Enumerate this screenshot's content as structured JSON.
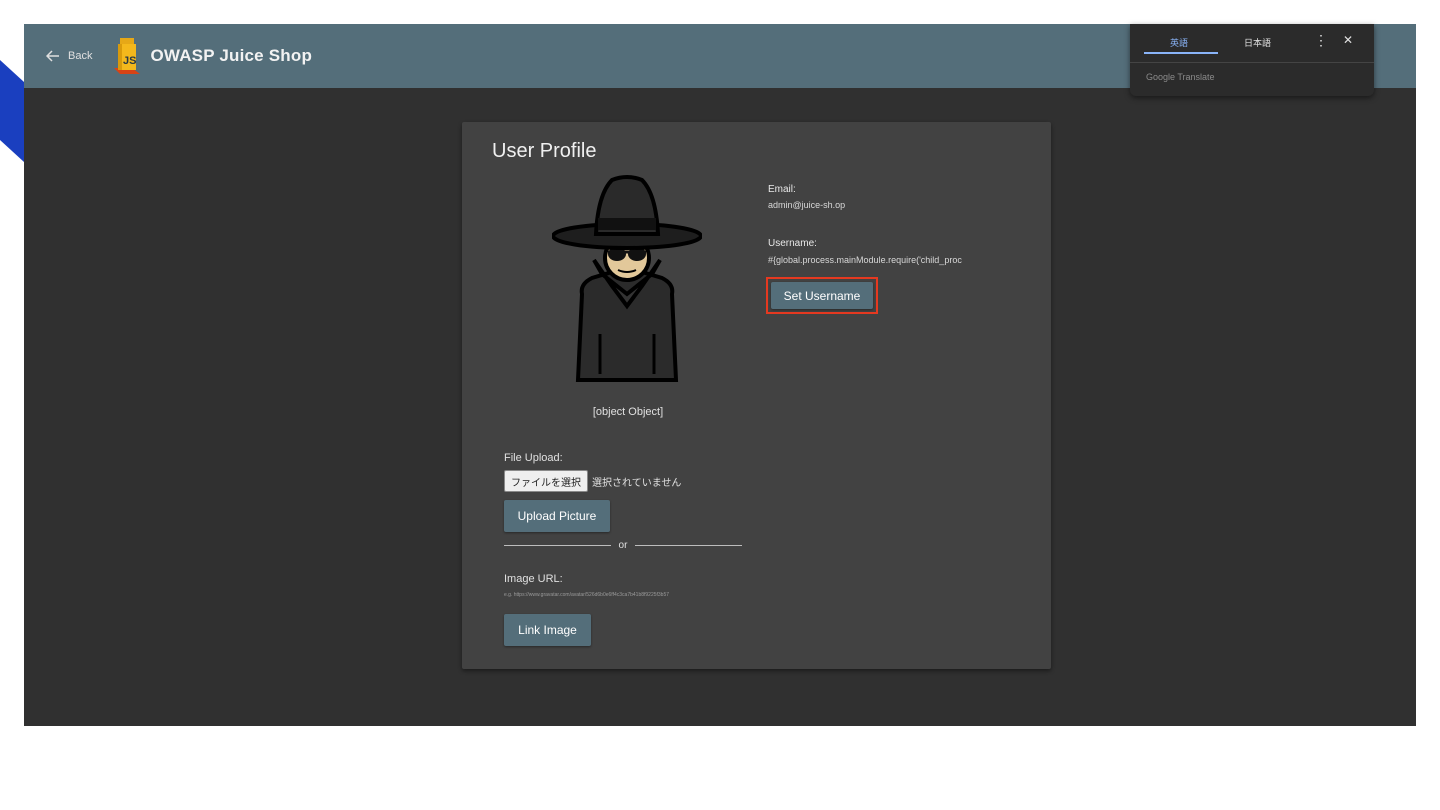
{
  "toolbar": {
    "back_label": "Back",
    "app_title": "OWASP Juice Shop",
    "color": "#546e7a"
  },
  "profile": {
    "title": "User Profile",
    "avatar_caption": "[object Object]",
    "email_label": "Email:",
    "email_value": "admin@juice-sh.op",
    "username_label": "Username:",
    "username_value": "#{global.process.mainModule.require('child_proc",
    "set_username_button": "Set Username",
    "file_upload_label": "File Upload:",
    "file_choose_button": "ファイルを選択",
    "file_status": "選択されていません",
    "upload_picture_button": "Upload Picture",
    "or_text": "or",
    "image_url_label": "Image URL:",
    "image_url_placeholder": "e.g. https://www.gravatar.com/avatar/526d6b0e6ff4c3ca7b41b8f9225f3b57",
    "link_image_button": "Link Image"
  },
  "translate_popup": {
    "tab_english": "英語",
    "tab_japanese": "日本語",
    "brand": "Google Translate",
    "accent": "#8ab4f8"
  },
  "icons": {
    "back": "arrow-back-icon",
    "logo": "juice-shop-logo",
    "more": "more-vert-icon",
    "close": "close-icon"
  },
  "colors": {
    "background": "#303030",
    "card": "#424242",
    "button": "#546e7a",
    "highlight": "#e53920",
    "corner_stripe": "#1a3fbf"
  }
}
